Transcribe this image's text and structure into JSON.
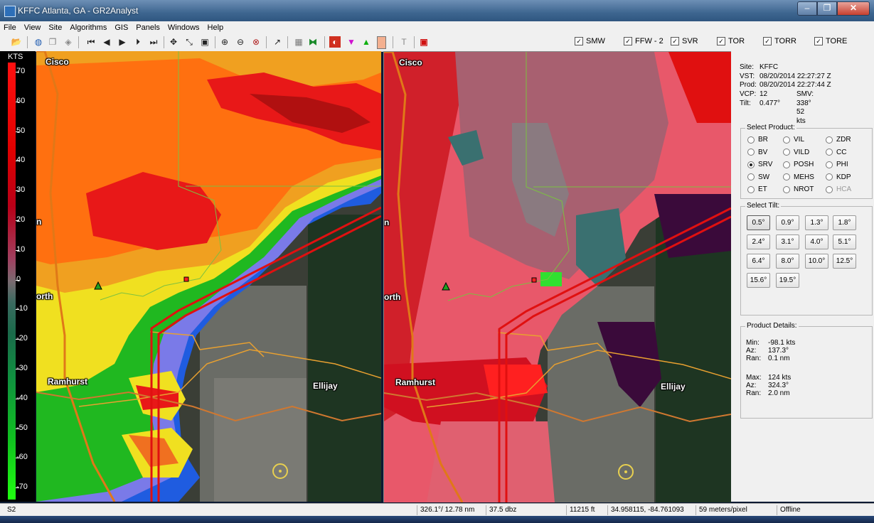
{
  "window": {
    "title": "KFFC Atlanta, GA - GR2Analyst",
    "min_glyph": "‒",
    "max_glyph": "❐",
    "close_glyph": "✕"
  },
  "menu": [
    "File",
    "View",
    "Site",
    "Algorithms",
    "GIS",
    "Panels",
    "Windows",
    "Help"
  ],
  "toolbar": {
    "icons": [
      "open-folder-icon",
      "globe-icon",
      "copy-icon",
      "layers-icon",
      "first-frame-icon",
      "step-back-icon",
      "play-icon",
      "step-forward-icon",
      "last-frame-icon",
      "pan-icon",
      "zoom-box-icon",
      "panel-icon",
      "zoom-in-icon",
      "zoom-out-icon",
      "zoom-reset-icon",
      "cursor-icon",
      "grid-icon",
      "split-icon",
      "color-icon",
      "funnel-down-icon",
      "funnel-up-icon",
      "rect-icon",
      "text-icon",
      "stop-icon"
    ],
    "warnings": [
      {
        "label": "SMW",
        "checked": true
      },
      {
        "label": "FFW - 2",
        "checked": true
      },
      {
        "label": "SVR",
        "checked": true
      },
      {
        "label": "TOR",
        "checked": true
      },
      {
        "label": "TORR",
        "checked": true
      },
      {
        "label": "TORE",
        "checked": true
      }
    ]
  },
  "legend": {
    "unit": "KTS",
    "labels": [
      "70",
      "60",
      "50",
      "40",
      "30",
      "20",
      "10",
      "0",
      "-10",
      "-20",
      "-30",
      "-40",
      "-50",
      "-60",
      "-70"
    ]
  },
  "map_labels": {
    "cisco": "Cisco",
    "north": "orth",
    "n_partial": "n",
    "ramhurst": "Ramhurst",
    "ellijay": "Ellijay"
  },
  "site_info": [
    {
      "k": "Site:",
      "v": "KFFC"
    },
    {
      "k": "VST:",
      "v": "08/20/2014  22:27:27 Z"
    },
    {
      "k": "Prod:",
      "v": "08/20/2014  22:27:44 Z"
    },
    {
      "k": "VCP:",
      "v": "12"
    },
    {
      "k": "Tilt:",
      "v": "0.477°"
    }
  ],
  "smv": "SMV: 338° 52 kts",
  "select_product": {
    "legend": "Select Product:",
    "options": [
      {
        "label": "BR",
        "selected": false,
        "disabled": false
      },
      {
        "label": "VIL",
        "selected": false,
        "disabled": false
      },
      {
        "label": "ZDR",
        "selected": false,
        "disabled": false
      },
      {
        "label": "BV",
        "selected": false,
        "disabled": false
      },
      {
        "label": "VILD",
        "selected": false,
        "disabled": false
      },
      {
        "label": "CC",
        "selected": false,
        "disabled": false
      },
      {
        "label": "SRV",
        "selected": true,
        "disabled": false
      },
      {
        "label": "POSH",
        "selected": false,
        "disabled": false
      },
      {
        "label": "PHI",
        "selected": false,
        "disabled": false
      },
      {
        "label": "SW",
        "selected": false,
        "disabled": false
      },
      {
        "label": "MEHS",
        "selected": false,
        "disabled": false
      },
      {
        "label": "KDP",
        "selected": false,
        "disabled": false
      },
      {
        "label": "ET",
        "selected": false,
        "disabled": false
      },
      {
        "label": "NROT",
        "selected": false,
        "disabled": false
      },
      {
        "label": "HCA",
        "selected": false,
        "disabled": true
      }
    ]
  },
  "select_tilt": {
    "legend": "Select Tilt:",
    "selected": "0.5°",
    "tilts": [
      "0.5°",
      "0.9°",
      "1.3°",
      "1.8°",
      "2.4°",
      "3.1°",
      "4.0°",
      "5.1°",
      "6.4°",
      "8.0°",
      "10.0°",
      "12.5°",
      "15.6°",
      "19.5°"
    ]
  },
  "product_details": {
    "legend": "Product Details:",
    "min": [
      {
        "k": "Min:",
        "v": "-98.1 kts"
      },
      {
        "k": "Az:",
        "v": "137.3°"
      },
      {
        "k": "Ran:",
        "v": "0.1 nm"
      }
    ],
    "max": [
      {
        "k": "Max:",
        "v": "124 kts"
      },
      {
        "k": "Az:",
        "v": "324.3°"
      },
      {
        "k": "Ran:",
        "v": "2.0 nm"
      }
    ]
  },
  "status": {
    "panel": "S2",
    "azran": "326.1°/ 12.78 nm",
    "dbz": "37.5 dbz",
    "height": "11215 ft",
    "latlon": "34.958115, -84.761093",
    "res": "59 meters/pixel",
    "conn": "Offline"
  },
  "colors": {
    "warning_red": "#e01010",
    "county_orange": "#e8a030",
    "road_orange": "#e07818",
    "county_green": "#7cc040"
  }
}
